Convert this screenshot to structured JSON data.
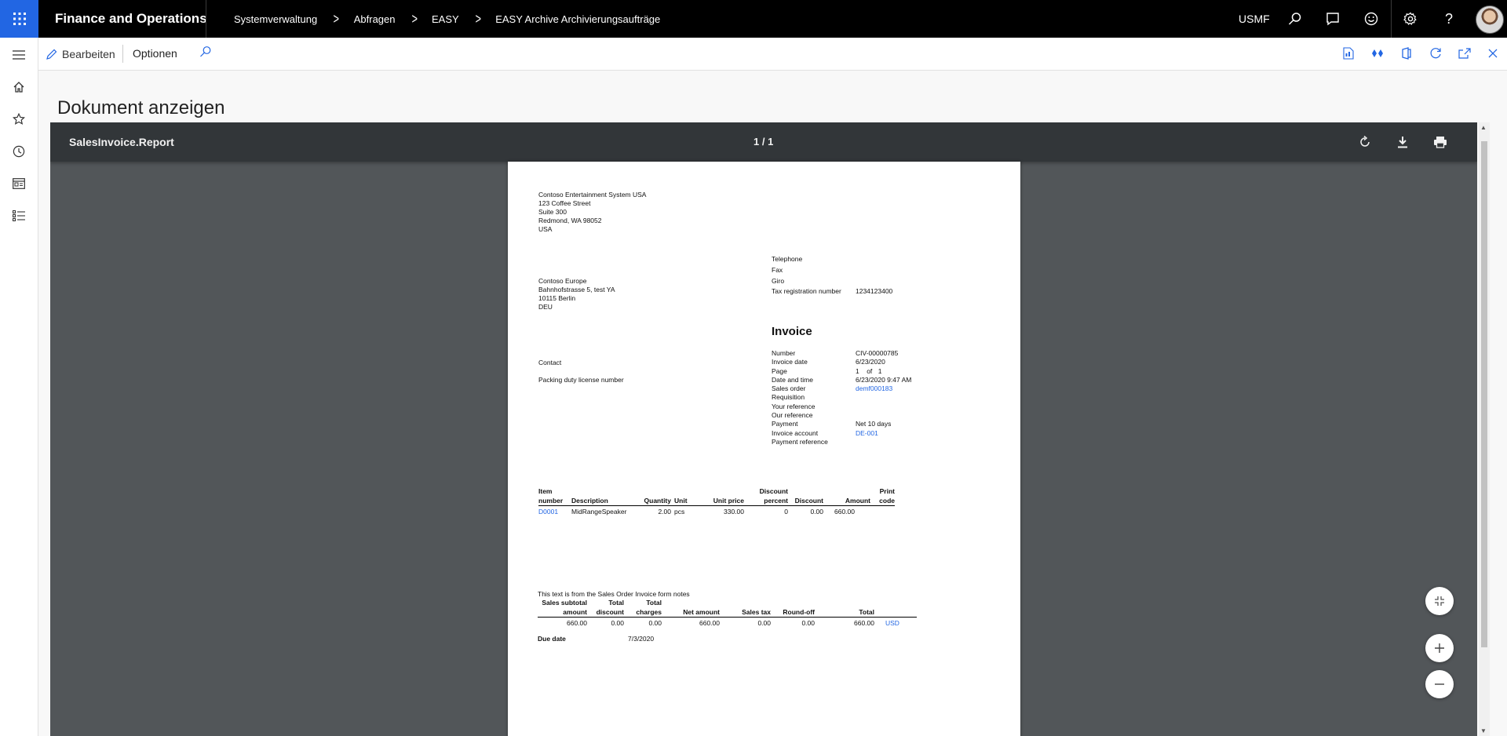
{
  "top": {
    "app_name": "Finance and Operations",
    "breadcrumbs": [
      "Systemverwaltung",
      "Abfragen",
      "EASY",
      "EASY Archive Archivierungsaufträge"
    ],
    "company": "USMF"
  },
  "actions": {
    "edit_label": "Bearbeiten",
    "options_label": "Optionen"
  },
  "page_title": "Dokument anzeigen",
  "viewer": {
    "title": "SalesInvoice.Report",
    "pages": "1 / 1"
  },
  "invoice": {
    "from": [
      "Contoso Entertainment System USA",
      "123 Coffee Street",
      "Suite 300",
      "Redmond, WA 98052",
      "USA"
    ],
    "company_info": {
      "telephone_label": "Telephone",
      "fax_label": "Fax",
      "giro_label": "Giro",
      "tax_label": "Tax registration number",
      "tax_value": "1234123400"
    },
    "to": [
      "Contoso Europe",
      "Bahnhofstrasse 5, test YA",
      "10115 Berlin",
      "DEU"
    ],
    "title": "Invoice",
    "contact_label": "Contact",
    "packing_label": "Packing duty license number",
    "details": {
      "number_label": "Number",
      "number": "CIV-00000785",
      "invoice_date_label": "Invoice date",
      "invoice_date": "6/23/2020",
      "page_label": "Page",
      "page_current": "1",
      "page_of": "of",
      "page_total": "1",
      "datetime_label": "Date and time",
      "datetime": "6/23/2020 9:47 AM",
      "sales_order_label": "Sales order",
      "sales_order": "demf000183",
      "requisition_label": "Requisition",
      "your_ref_label": "Your reference",
      "our_ref_label": "Our reference",
      "payment_label": "Payment",
      "payment": "Net 10 days",
      "account_label": "Invoice account",
      "account": "DE-001",
      "payref_label": "Payment reference"
    },
    "lines_headers": {
      "item_1": "Item",
      "item_2": "number",
      "description": "Description",
      "quantity": "Quantity",
      "unit": "Unit",
      "unit_price": "Unit price",
      "discount_pct_1": "Discount",
      "discount_pct_2": "percent",
      "discount": "Discount",
      "amount": "Amount",
      "print_code_1": "Print",
      "print_code_2": "code"
    },
    "line": {
      "item": "D0001",
      "description": "MidRangeSpeaker",
      "quantity": "2.00",
      "unit": "pcs",
      "unit_price": "330.00",
      "discount_pct": "0",
      "discount": "0.00",
      "amount": "660.00"
    },
    "note": "This text is from the Sales Order Invoice form notes",
    "totals_headers": {
      "subtotal_1": "Sales subtotal",
      "subtotal_2": "amount",
      "total_discount_1": "Total",
      "total_discount_2": "discount",
      "total_charges_1": "Total",
      "total_charges_2": "charges",
      "net_amount": "Net amount",
      "sales_tax": "Sales tax",
      "round_off": "Round-off",
      "total": "Total"
    },
    "totals": {
      "subtotal": "660.00",
      "total_discount": "0.00",
      "total_charges": "0.00",
      "net_amount": "660.00",
      "sales_tax": "0.00",
      "round_off": "0.00",
      "total": "660.00",
      "currency": "USD"
    },
    "due_date_label": "Due date",
    "due_date": "7/3/2020"
  },
  "icons": {
    "waffle": "app-launcher-icon",
    "search": "search-icon",
    "feedback": "chat-icon",
    "smile": "smiley-icon",
    "settings": "gear-icon",
    "help": "help-icon"
  },
  "colors": {
    "accent": "#2266e3",
    "topbar": "#000000",
    "viewer_bg": "#525659",
    "viewer_toolbar": "#323639"
  }
}
